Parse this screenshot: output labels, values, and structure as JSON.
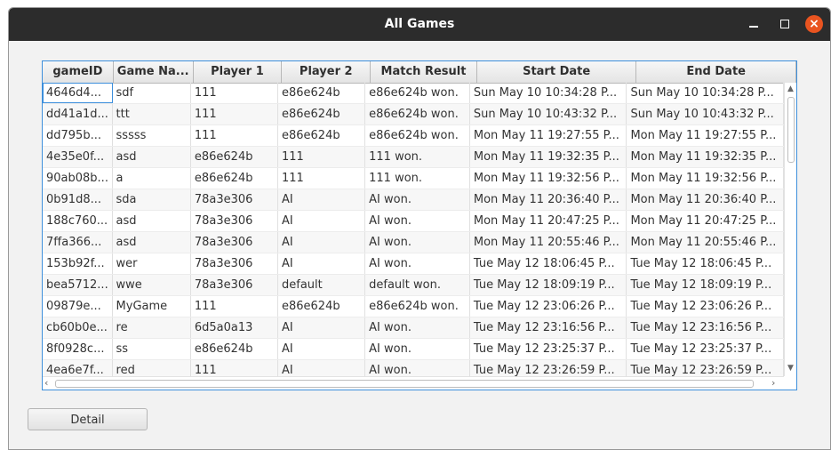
{
  "window": {
    "title": "All Games",
    "close_glyph": "×"
  },
  "table": {
    "columns": [
      "gameID",
      "Game Na...",
      "Player 1",
      "Player 2",
      "Match Result",
      "Start Date",
      "End Date"
    ],
    "rows": [
      [
        "4646d4...",
        "sdf",
        "111",
        "e86e624b",
        "e86e624b won.",
        "Sun May 10 10:34:28 P...",
        "Sun May 10 10:34:28 P..."
      ],
      [
        "dd41a1d...",
        "ttt",
        "111",
        "e86e624b",
        "e86e624b won.",
        "Sun May 10 10:43:32 P...",
        "Sun May 10 10:43:32 P..."
      ],
      [
        "dd795b...",
        "sssss",
        "111",
        "e86e624b",
        "e86e624b won.",
        "Mon May 11 19:27:55 P...",
        "Mon May 11 19:27:55 P..."
      ],
      [
        "4e35e0f...",
        "asd",
        "e86e624b",
        "111",
        "111 won.",
        "Mon May 11 19:32:35 P...",
        "Mon May 11 19:32:35 P..."
      ],
      [
        "90ab08b...",
        "a",
        "e86e624b",
        "111",
        "111 won.",
        "Mon May 11 19:32:56 P...",
        "Mon May 11 19:32:56 P..."
      ],
      [
        "0b91d8...",
        "sda",
        "78a3e306",
        "AI",
        "AI won.",
        "Mon May 11 20:36:40 P...",
        "Mon May 11 20:36:40 P..."
      ],
      [
        "188c760...",
        "asd",
        "78a3e306",
        "AI",
        "AI won.",
        "Mon May 11 20:47:25 P...",
        "Mon May 11 20:47:25 P..."
      ],
      [
        "7ffa366...",
        "asd",
        "78a3e306",
        "AI",
        "AI won.",
        "Mon May 11 20:55:46 P...",
        "Mon May 11 20:55:46 P..."
      ],
      [
        "153b92f...",
        "wer",
        "78a3e306",
        "AI",
        "AI won.",
        "Tue May 12 18:06:45 P...",
        "Tue May 12 18:06:45 P..."
      ],
      [
        "bea5712...",
        "wwe",
        "78a3e306",
        "default",
        "default won.",
        "Tue May 12 18:09:19 P...",
        "Tue May 12 18:09:19 P..."
      ],
      [
        "09879e...",
        "MyGame",
        "111",
        "e86e624b",
        "e86e624b won.",
        "Tue May 12 23:06:26 P...",
        "Tue May 12 23:06:26 P..."
      ],
      [
        "cb60b0e...",
        "re",
        "6d5a0a13",
        "AI",
        "AI won.",
        "Tue May 12 23:16:56 P...",
        "Tue May 12 23:16:56 P..."
      ],
      [
        "8f0928c...",
        "ss",
        "e86e624b",
        "AI",
        "AI won.",
        "Tue May 12 23:25:37 P...",
        "Tue May 12 23:25:37 P..."
      ],
      [
        "4ea6e7f...",
        "red",
        "111",
        "AI",
        "AI won.",
        "Tue May 12 23:26:59 P...",
        "Tue May 12 23:26:59 P..."
      ]
    ]
  },
  "buttons": {
    "detail": "Detail"
  },
  "colors": {
    "titlebar": "#2c2c2c",
    "close": "#e95420",
    "focus": "#3d8fdc"
  },
  "icons": {
    "minimize": "minimize-icon",
    "maximize": "maximize-icon",
    "close": "close-icon"
  }
}
